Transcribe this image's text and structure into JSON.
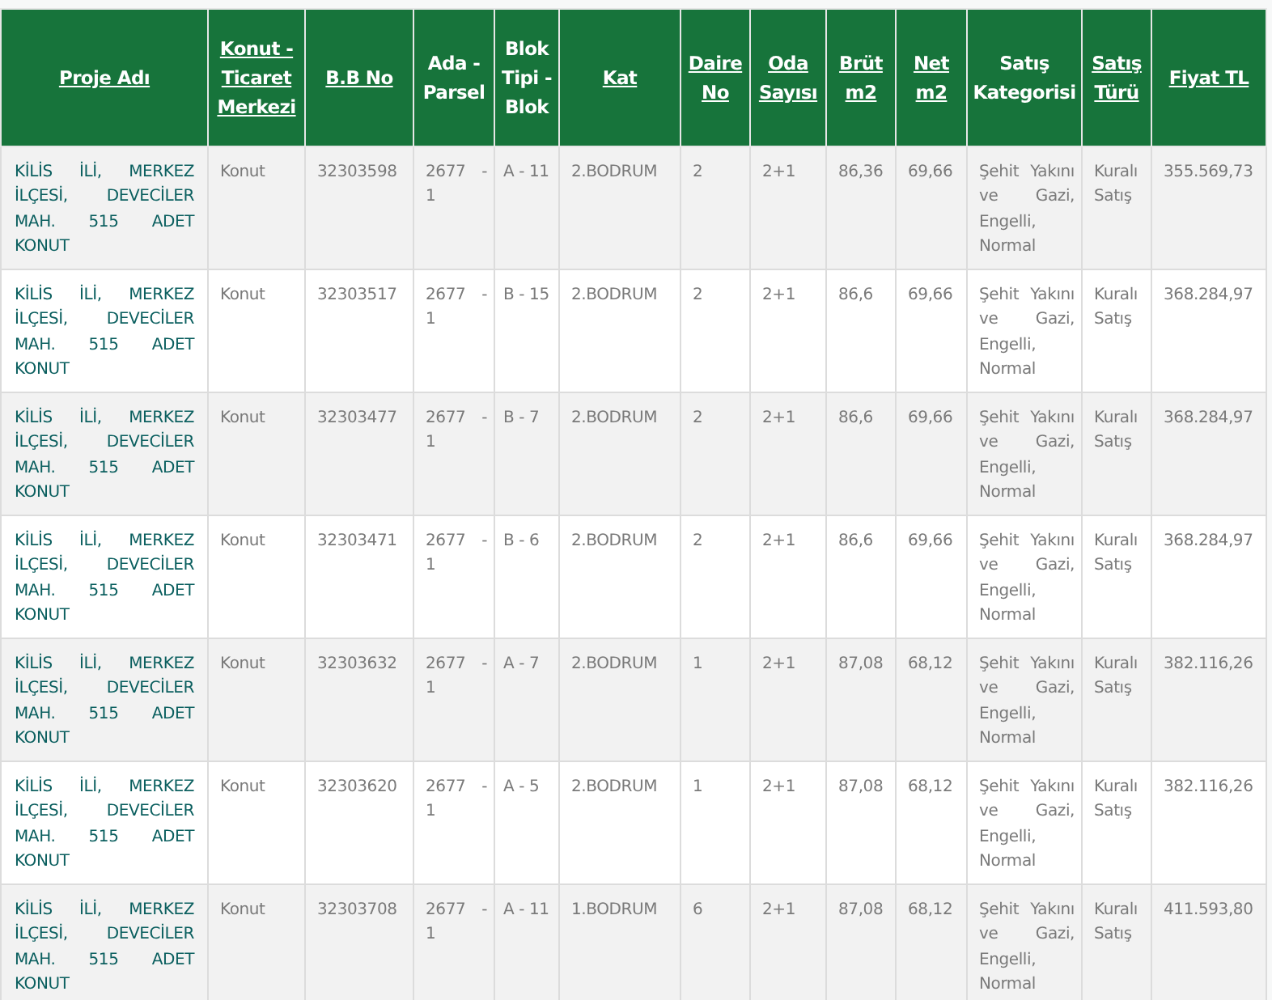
{
  "table": {
    "columns": [
      {
        "label": "Proje Adı",
        "sortable": true
      },
      {
        "label": "Konut - Ticaret Merkezi",
        "sortable": true
      },
      {
        "label": "B.B No",
        "sortable": true
      },
      {
        "label": "Ada - Parsel",
        "sortable": false
      },
      {
        "label": "Blok Tipi - Blok",
        "sortable": false
      },
      {
        "label": "Kat",
        "sortable": true
      },
      {
        "label": "Daire No",
        "sortable": true
      },
      {
        "label": "Oda Sayısı",
        "sortable": true
      },
      {
        "label": "Brüt m2",
        "sortable": true
      },
      {
        "label": "Net m2",
        "sortable": true
      },
      {
        "label": "Satış Kategorisi",
        "sortable": false
      },
      {
        "label": "Satış Türü",
        "sortable": true
      },
      {
        "label": "Fiyat TL",
        "sortable": true
      }
    ],
    "rows": [
      [
        "KİLİS İLİ, MERKEZ İLÇESİ, DEVECİLER MAH. 515 ADET KONUT",
        "Konut",
        "32303598",
        "2677 - 1",
        "A - 11",
        "2.BODRUM",
        "2",
        "2+1",
        "86,36",
        "69,66",
        "Şehit Yakını ve Gazi, Engelli, Normal",
        "Kuralı Satış",
        "355.569,73"
      ],
      [
        "KİLİS İLİ, MERKEZ İLÇESİ, DEVECİLER MAH. 515 ADET KONUT",
        "Konut",
        "32303517",
        "2677 - 1",
        "B - 15",
        "2.BODRUM",
        "2",
        "2+1",
        "86,6",
        "69,66",
        "Şehit Yakını ve Gazi, Engelli, Normal",
        "Kuralı Satış",
        "368.284,97"
      ],
      [
        "KİLİS İLİ, MERKEZ İLÇESİ, DEVECİLER MAH. 515 ADET KONUT",
        "Konut",
        "32303477",
        "2677 - 1",
        "B - 7",
        "2.BODRUM",
        "2",
        "2+1",
        "86,6",
        "69,66",
        "Şehit Yakını ve Gazi, Engelli, Normal",
        "Kuralı Satış",
        "368.284,97"
      ],
      [
        "KİLİS İLİ, MERKEZ İLÇESİ, DEVECİLER MAH. 515 ADET KONUT",
        "Konut",
        "32303471",
        "2677 - 1",
        "B - 6",
        "2.BODRUM",
        "2",
        "2+1",
        "86,6",
        "69,66",
        "Şehit Yakını ve Gazi, Engelli, Normal",
        "Kuralı Satış",
        "368.284,97"
      ],
      [
        "KİLİS İLİ, MERKEZ İLÇESİ, DEVECİLER MAH. 515 ADET KONUT",
        "Konut",
        "32303632",
        "2677 - 1",
        "A - 7",
        "2.BODRUM",
        "1",
        "2+1",
        "87,08",
        "68,12",
        "Şehit Yakını ve Gazi, Engelli, Normal",
        "Kuralı Satış",
        "382.116,26"
      ],
      [
        "KİLİS İLİ, MERKEZ İLÇESİ, DEVECİLER MAH. 515 ADET KONUT",
        "Konut",
        "32303620",
        "2677 - 1",
        "A - 5",
        "2.BODRUM",
        "1",
        "2+1",
        "87,08",
        "68,12",
        "Şehit Yakını ve Gazi, Engelli, Normal",
        "Kuralı Satış",
        "382.116,26"
      ],
      [
        "KİLİS İLİ, MERKEZ İLÇESİ, DEVECİLER MAH. 515 ADET KONUT",
        "Konut",
        "32303708",
        "2677 - 1",
        "A - 11",
        "1.BODRUM",
        "6",
        "2+1",
        "87,08",
        "68,12",
        "Şehit Yakını ve Gazi, Engelli, Normal",
        "Kuralı Satış",
        "411.593,80"
      ]
    ]
  }
}
